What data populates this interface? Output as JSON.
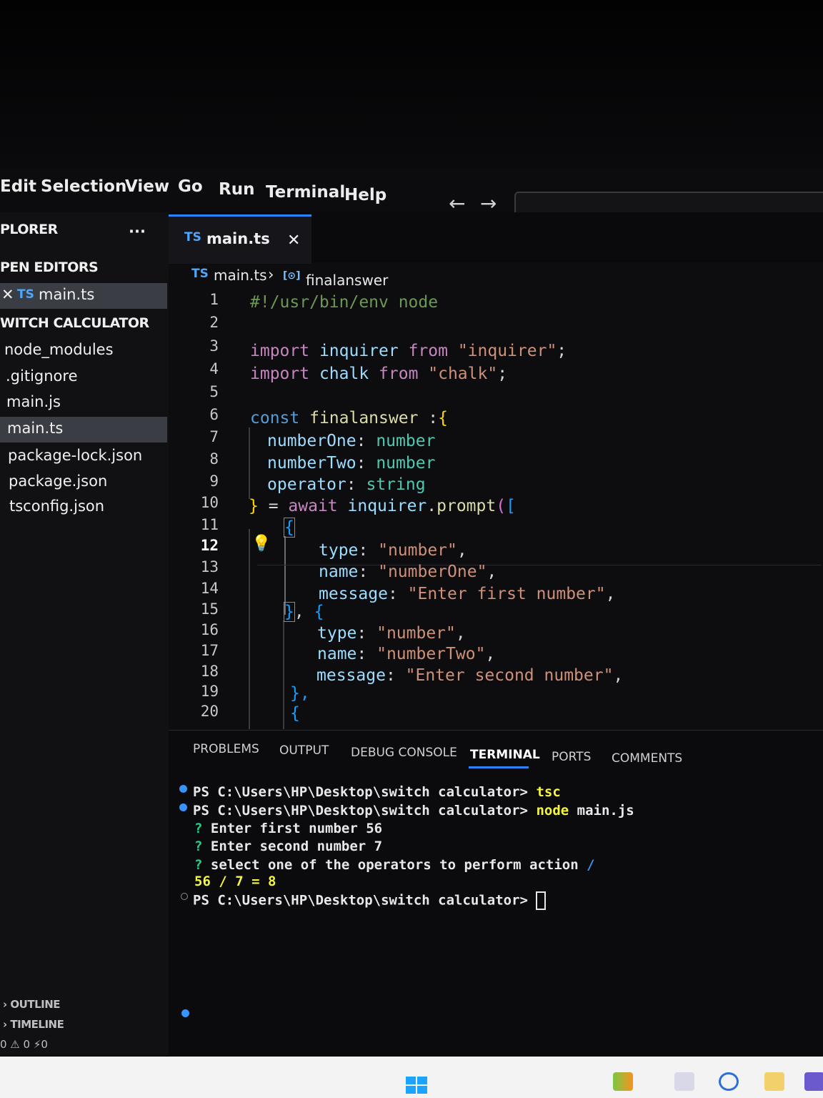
{
  "menu": [
    "Edit",
    "Selection",
    "View",
    "Go",
    "Run",
    "Terminal",
    "Help"
  ],
  "sidebar": {
    "title": "PLORER",
    "more": "···",
    "open_editors": "PEN EDITORS",
    "open_file_badge": "TS",
    "open_file": "main.ts",
    "folder": "WITCH CALCULATOR",
    "files": [
      "node_modules",
      ".gitignore",
      "main.js",
      "main.ts",
      "package-lock.json",
      "package.json",
      "tsconfig.json"
    ],
    "outline": "OUTLINE",
    "timeline": "TIMELINE",
    "status": "0 ⚠ 0   ⚡0"
  },
  "tab": {
    "badge": "TS",
    "label": "main.ts",
    "close": "✕"
  },
  "breadcrumb": {
    "badge": "TS",
    "file": "main.ts",
    "sep": "›",
    "symbol_icon": "[⊙]",
    "symbol": "finalanswer"
  },
  "line_numbers": [
    "1",
    "2",
    "3",
    "4",
    "5",
    "6",
    "7",
    "8",
    "9",
    "10",
    "11",
    "12",
    "13",
    "14",
    "15",
    "16",
    "17",
    "18",
    "19",
    "20"
  ],
  "code": {
    "l1": "#!/usr/bin/env node",
    "l3a": "import",
    "l3b": " inquirer ",
    "l3c": "from",
    "l3d": " \"inquirer\"",
    "l3e": ";",
    "l4a": "import",
    "l4b": " chalk ",
    "l4c": "from",
    "l4d": " \"chalk\"",
    "l4e": ";",
    "l6a": "const",
    "l6b": " finalanswer ",
    "l6c": ":",
    "l6d": "{",
    "l7a": "numberOne",
    "l7b": ": ",
    "l7c": "number",
    "l8a": "numberTwo",
    "l8b": ": ",
    "l8c": "number",
    "l9a": "operator",
    "l9b": ": ",
    "l9c": "string",
    "l10a": "}",
    "l10b": " = ",
    "l10c": "await",
    "l10d": " inquirer",
    "l10e": ".",
    "l10f": "prompt",
    "l10g": "(",
    "l10h": "[",
    "l11": "{",
    "l12a": "type",
    "l12b": ": ",
    "l12c": "\"number\"",
    "l12d": ",",
    "l13a": "name",
    "l13b": ": ",
    "l13c": "\"numberOne\"",
    "l13d": ",",
    "l14a": "message",
    "l14b": ": ",
    "l14c": "\"Enter first number\"",
    "l14d": ",",
    "l15a": "}",
    "l15b": ", ",
    "l15c": "{",
    "l16a": "type",
    "l16b": ": ",
    "l16c": "\"number\"",
    "l16d": ",",
    "l17a": "name",
    "l17b": ": ",
    "l17c": "\"numberTwo\"",
    "l17d": ",",
    "l18a": "message",
    "l18b": ": ",
    "l18c": "\"Enter second number\"",
    "l18d": ",",
    "l19": "},",
    "l20": "{"
  },
  "panel_tabs": [
    "PROBLEMS",
    "OUTPUT",
    "DEBUG CONSOLE",
    "TERMINAL",
    "PORTS",
    "COMMENTS"
  ],
  "terminal": {
    "prompt": "PS C:\\Users\\HP\\Desktop\\switch calculator> ",
    "cmd1": "tsc",
    "cmd2a": "node",
    "cmd2b": " main.js",
    "q1a": "? ",
    "q1b": "Enter first number",
    "q1c": " 56",
    "q2a": "? ",
    "q2b": "Enter second number",
    "q2c": " 7",
    "q3a": "? ",
    "q3b": "select one of the operators to perform action",
    "q3c": " /",
    "result": "56 / 7 = 8"
  },
  "colors": {
    "accent": "#2f81f7",
    "ts": "#4fa6ff",
    "terminal_dot": "#3794ff"
  }
}
